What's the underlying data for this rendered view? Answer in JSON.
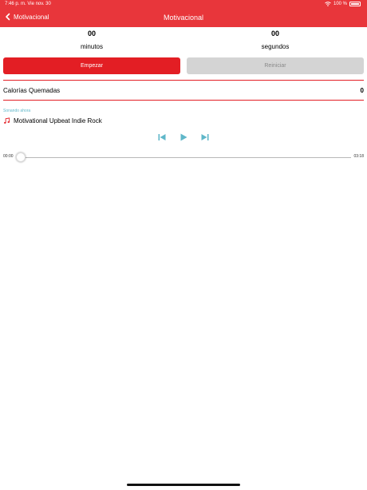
{
  "status_bar": {
    "time_date": "7:46 p. m.   Vie nov. 30",
    "battery": "100 %"
  },
  "nav": {
    "back_label": "Motivacional",
    "title": "Motivacional"
  },
  "timer": {
    "minutes_value": "00",
    "minutes_label": "minutos",
    "seconds_value": "00",
    "seconds_label": "segundos"
  },
  "buttons": {
    "start_label": "Empezar",
    "reset_label": "Reiniciar"
  },
  "calories": {
    "label": "Calorías Quemadas",
    "value": "0"
  },
  "music": {
    "section_caption": "Sonando ahora",
    "track_title": "Motivational Upbeat Indie Rock",
    "elapsed": "00:00",
    "duration": "03:18",
    "progress": 0
  },
  "colors": {
    "accent": "#e31e24",
    "header": "#e8363b",
    "player_icons": "#5fb7c9"
  },
  "icons": {
    "back": "chevron-left-icon",
    "wifi": "wifi-icon",
    "battery": "battery-icon",
    "note": "music-note-icon",
    "prev": "skip-previous-icon",
    "play": "play-icon",
    "next": "skip-next-icon"
  }
}
